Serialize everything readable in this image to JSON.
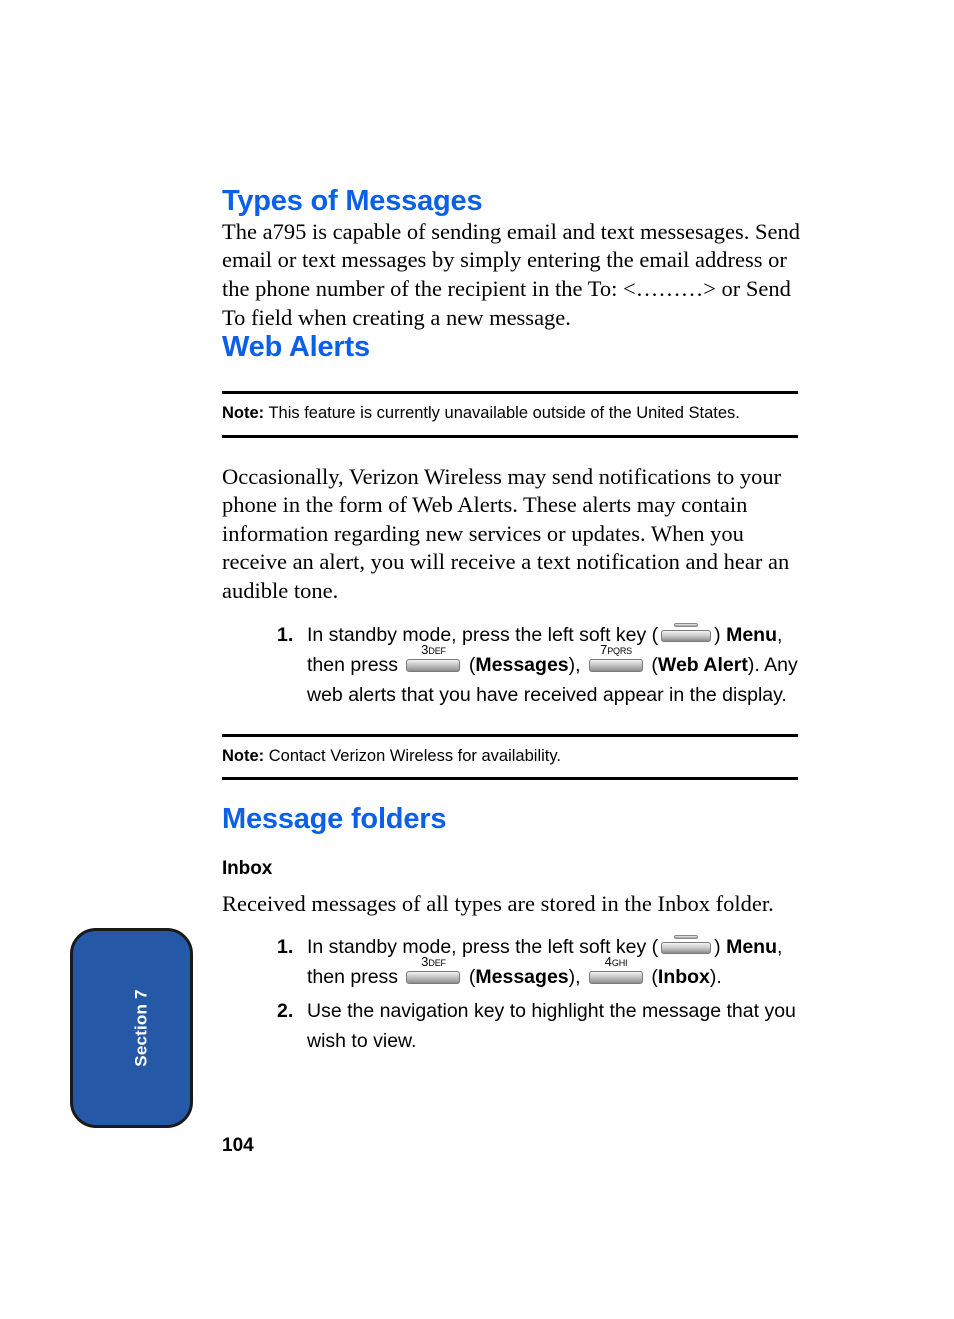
{
  "page": {
    "number": "104",
    "section_tab_label": "Section 7",
    "heading_color": "#0b5fe8",
    "tab_color": "#2559a8"
  },
  "sections": {
    "types_of_messages": {
      "heading": "Types of Messages",
      "paragraph": "The a795 is capable of sending email and text messesages. Send email or text messages by simply entering the email address  or the phone number of the recipient in the To: <………>  or Send To field when creating a new message."
    },
    "web_alerts": {
      "heading": "Web Alerts",
      "note_top": {
        "label": "Note:",
        "text": " This feature is currently unavailable outside of the United States."
      },
      "paragraph": "Occasionally, Verizon Wireless may send notifications to your phone in the form of Web Alerts. These alerts may contain information regarding new services or updates. When you receive an alert, you will receive a text notification and hear an audible tone.",
      "steps": [
        {
          "num": "1.",
          "t1": "In standby mode, press the left soft key (",
          "softkey_icon": "left-soft-key",
          "t2": ") ",
          "b1": "Menu",
          "t3": ", then press ",
          "key1_digit": "3",
          "key1_letters": "DEF",
          "t4": " (",
          "b2": "Messages",
          "t5": "), ",
          "key2_digit": "7",
          "key2_letters": "PQRS",
          "t6": " (",
          "b3": "Web Alert",
          "t7": "). Any web alerts that you have received appear in the display."
        }
      ],
      "note_bottom": {
        "label": "Note:",
        "text": " Contact Verizon Wireless for availability."
      }
    },
    "message_folders": {
      "heading": "Message folders",
      "inbox": {
        "subheading": "Inbox",
        "paragraph": "Received messages of all types are stored in the Inbox folder.",
        "steps": [
          {
            "num": "1.",
            "t1": "In standby mode, press the left soft key (",
            "softkey_icon": "left-soft-key",
            "t2": ") ",
            "b1": "Menu",
            "t3": ", then press ",
            "key1_digit": "3",
            "key1_letters": "DEF",
            "t4": " (",
            "b2": "Messages",
            "t5": "), ",
            "key2_digit": "4",
            "key2_letters": "GHI",
            "t6": " (",
            "b3": "Inbox",
            "t7": ")."
          },
          {
            "num": "2.",
            "text": "Use the navigation key to highlight the message that you wish to view."
          }
        ]
      }
    }
  }
}
